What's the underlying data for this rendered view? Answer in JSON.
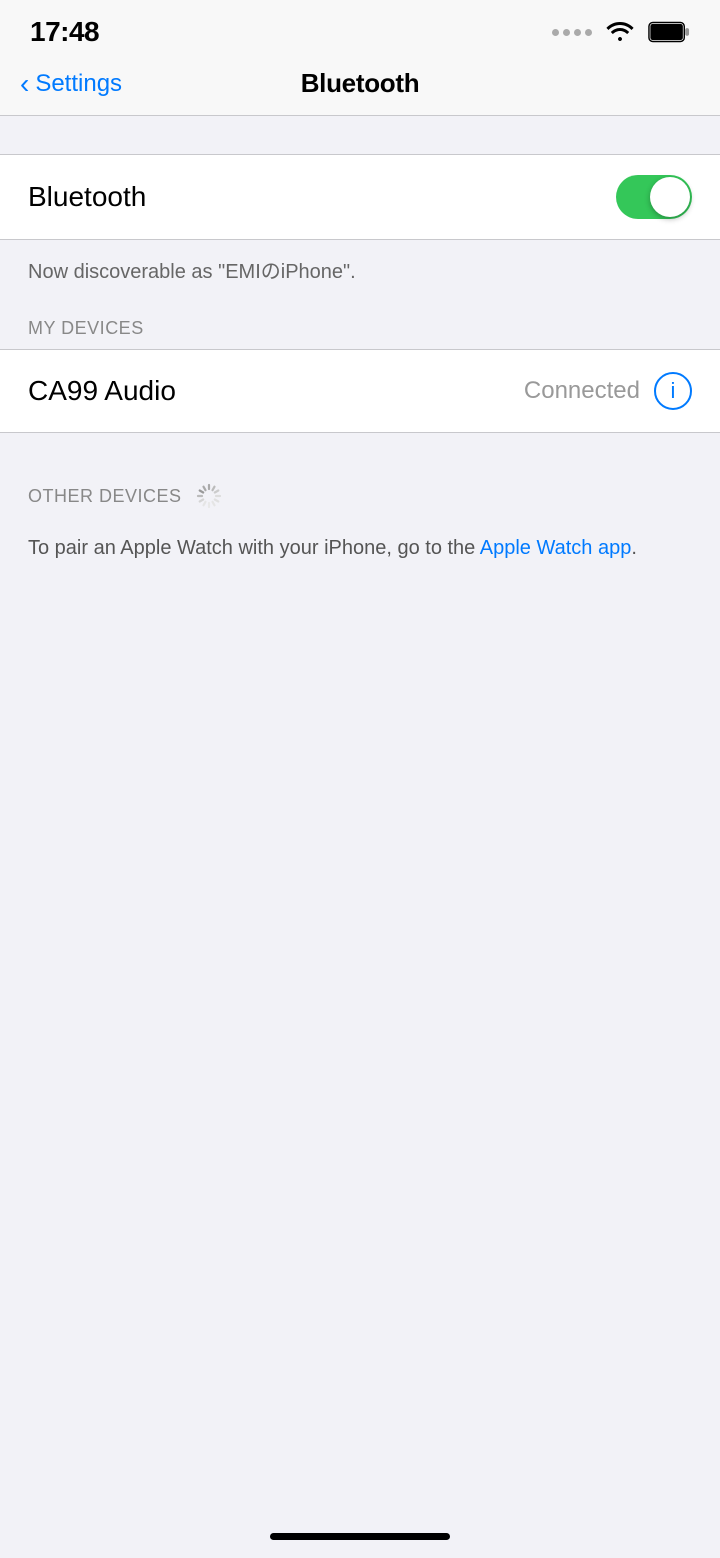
{
  "statusBar": {
    "time": "17:48",
    "wifiLabel": "wifi",
    "batteryLabel": "battery"
  },
  "navBar": {
    "backLabel": "Settings",
    "title": "Bluetooth"
  },
  "bluetoothToggle": {
    "label": "Bluetooth",
    "enabled": true
  },
  "discoverableText": "Now discoverable as \"EMIのiPhone\".",
  "myDevices": {
    "sectionHeader": "MY DEVICES",
    "devices": [
      {
        "name": "CA99 Audio",
        "status": "Connected",
        "infoButton": "ⓘ"
      }
    ]
  },
  "otherDevices": {
    "sectionHeader": "OTHER DEVICES",
    "appleWatchNote": "To pair an Apple Watch with your iPhone, go to the ",
    "appleWatchLink": "Apple Watch app",
    "appleWatchNoteEnd": "."
  },
  "homeIndicator": "home-bar"
}
